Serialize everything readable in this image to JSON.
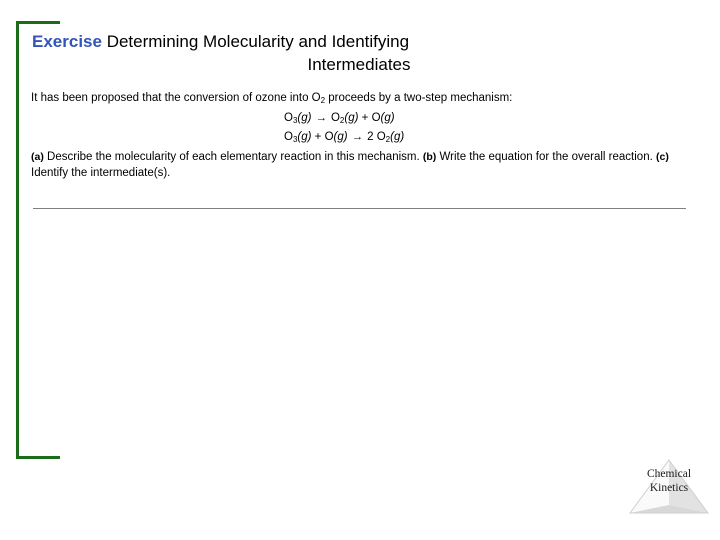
{
  "slide": {
    "background_color": "#ffffff",
    "accent_green": "#1a6b1a",
    "accent_blue": "#3355bb",
    "rule_color": "#808080"
  },
  "title": {
    "exercise_label": "Exercise",
    "heading_line1": "Determining Molecularity and Identifying",
    "heading_line2": "Intermediates"
  },
  "body": {
    "intro_prefix": "It has been proposed that the conversion of ozone into O",
    "intro_sub": "2",
    "intro_suffix": " proceeds by a two-step mechanism:",
    "equations": [
      {
        "id": "step-1",
        "reactant_species": "O",
        "reactant_sub": "3",
        "reactant_state": "(g)",
        "arrow": "→",
        "product1_species": "O",
        "product1_sub": "2",
        "product1_state": "(g)",
        "plus": "+",
        "product2_species": "O",
        "product2_state": "(g)",
        "plain": "O3(g) → O2(g) + O(g)"
      },
      {
        "id": "step-2",
        "reactant1_species": "O",
        "reactant1_sub": "3",
        "reactant1_state": "(g)",
        "plus": "+",
        "reactant2_species": "O",
        "reactant2_state": "(g)",
        "arrow": "→",
        "coefficient": "2",
        "product_species": "O",
        "product_sub": "2",
        "product_state": "(g)",
        "plain": "O3(g) + O(g) → 2 O2(g)"
      }
    ],
    "question_a_label": "(a)",
    "question_a_text": " Describe the molecularity of each elementary reaction in this mechanism. ",
    "question_b_label": "(b)",
    "question_b_text": " Write the equation for the overall reaction. ",
    "question_c_label": "(c)",
    "question_c_text": " Identify the intermediate(s)."
  },
  "logo": {
    "line1": "Chemical",
    "line2": "Kinetics",
    "shape": "triangle-pyramid"
  }
}
